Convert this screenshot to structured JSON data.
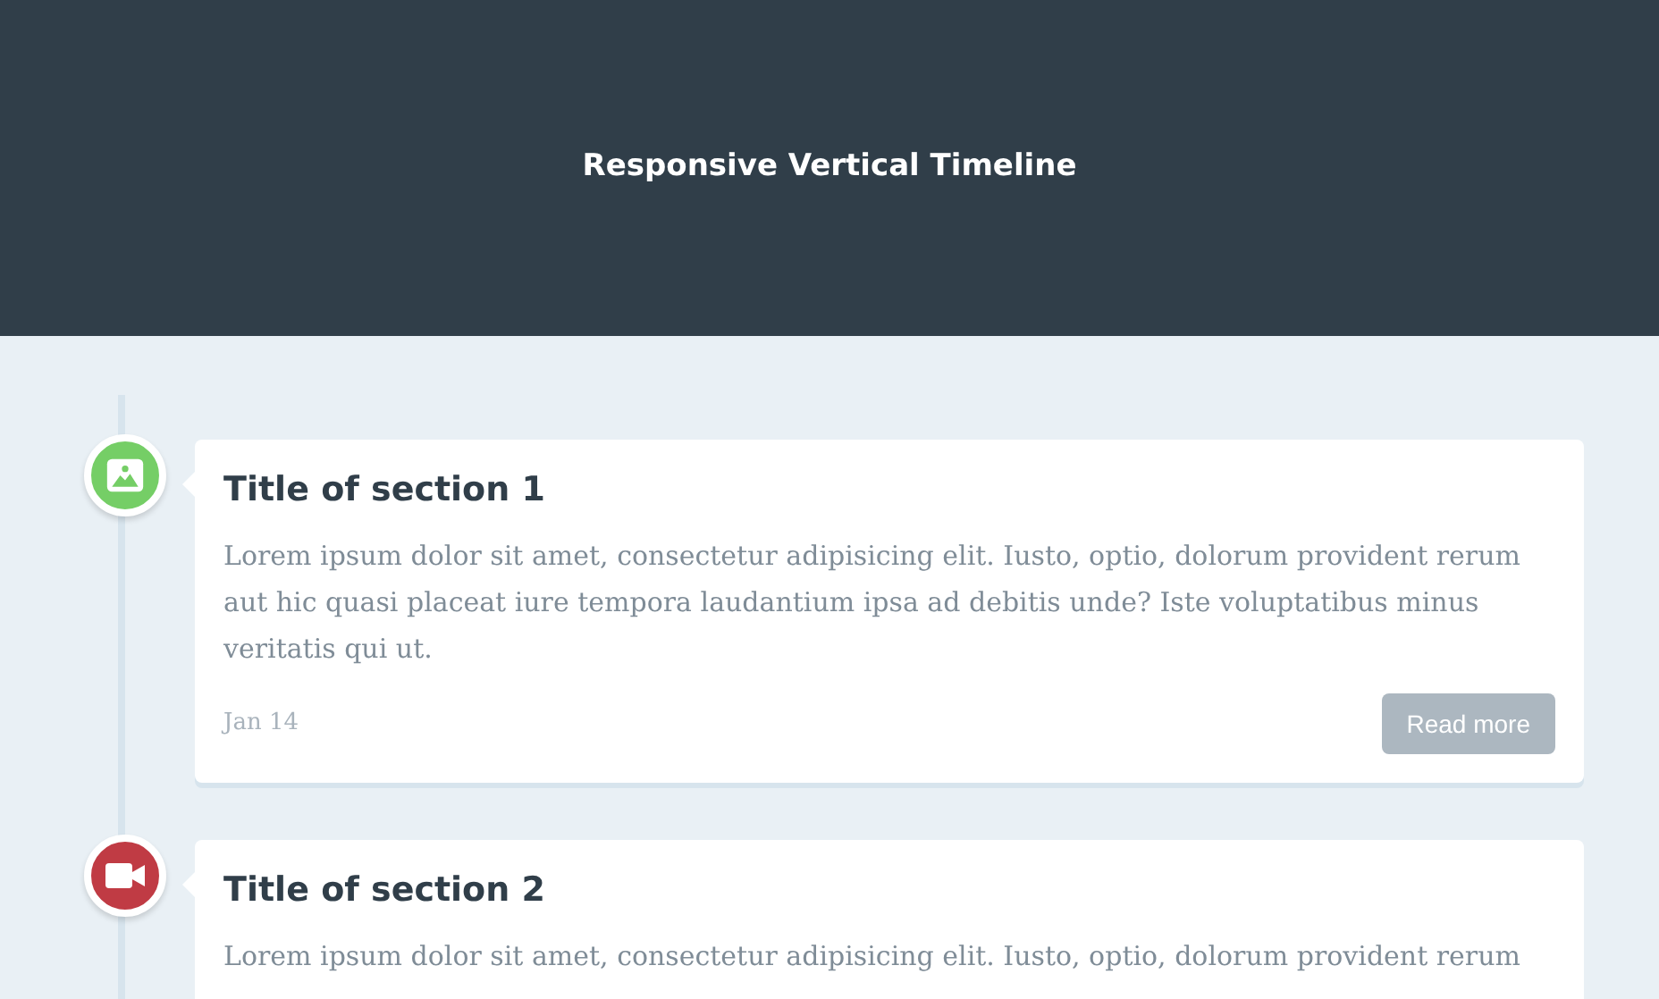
{
  "header": {
    "title": "Responsive Vertical Timeline"
  },
  "timeline": [
    {
      "kind": "image",
      "color": "#75ce66",
      "title": "Title of section 1",
      "body": "Lorem ipsum dolor sit amet, consectetur adipisicing elit. Iusto, optio, dolorum provident rerum aut hic quasi placeat iure tempora laudantium ipsa ad debitis unde? Iste voluptatibus minus veritatis qui ut.",
      "date": "Jan 14",
      "button": "Read more"
    },
    {
      "kind": "video",
      "color": "#c03b44",
      "title": "Title of section 2",
      "body": "Lorem ipsum dolor sit amet, consectetur adipisicing elit. Iusto, optio, dolorum provident rerum"
    }
  ]
}
